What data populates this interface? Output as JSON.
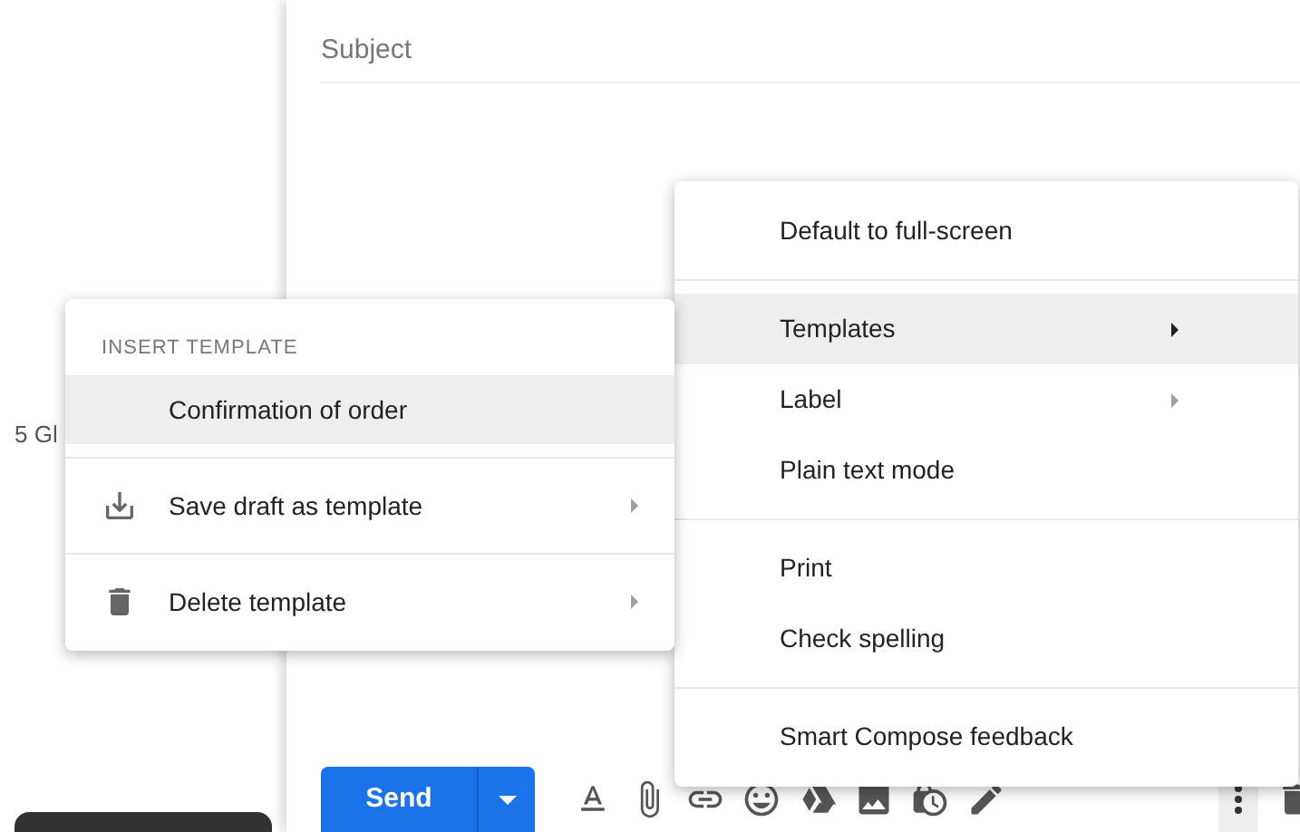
{
  "background_text": "5 Gl",
  "compose": {
    "subject": {
      "placeholder": "Subject"
    },
    "send_button": {
      "label": "Send"
    },
    "more_options": {
      "selected": true
    }
  },
  "more_menu": {
    "items": [
      {
        "kind": "item",
        "label": "Default to full-screen",
        "submenu": false,
        "selected": false
      },
      {
        "kind": "divider"
      },
      {
        "kind": "item",
        "label": "Templates",
        "submenu": true,
        "selected": true
      },
      {
        "kind": "item",
        "label": "Label",
        "submenu": true,
        "selected": false
      },
      {
        "kind": "item",
        "label": "Plain text mode",
        "submenu": false,
        "selected": false
      },
      {
        "kind": "divider"
      },
      {
        "kind": "item",
        "label": "Print",
        "submenu": false,
        "selected": false
      },
      {
        "kind": "item",
        "label": "Check spelling",
        "submenu": false,
        "selected": false
      },
      {
        "kind": "divider"
      },
      {
        "kind": "item",
        "label": "Smart Compose feedback",
        "submenu": false,
        "selected": false
      }
    ]
  },
  "templates_menu": {
    "header": "INSERT TEMPLATE",
    "items": [
      {
        "kind": "template",
        "label": "Confirmation of order",
        "selected": true
      },
      {
        "kind": "divider"
      },
      {
        "kind": "save",
        "label": "Save draft as template",
        "submenu": true,
        "selected": false
      },
      {
        "kind": "divider"
      },
      {
        "kind": "delete",
        "label": "Delete template",
        "submenu": true,
        "selected": false
      }
    ]
  }
}
